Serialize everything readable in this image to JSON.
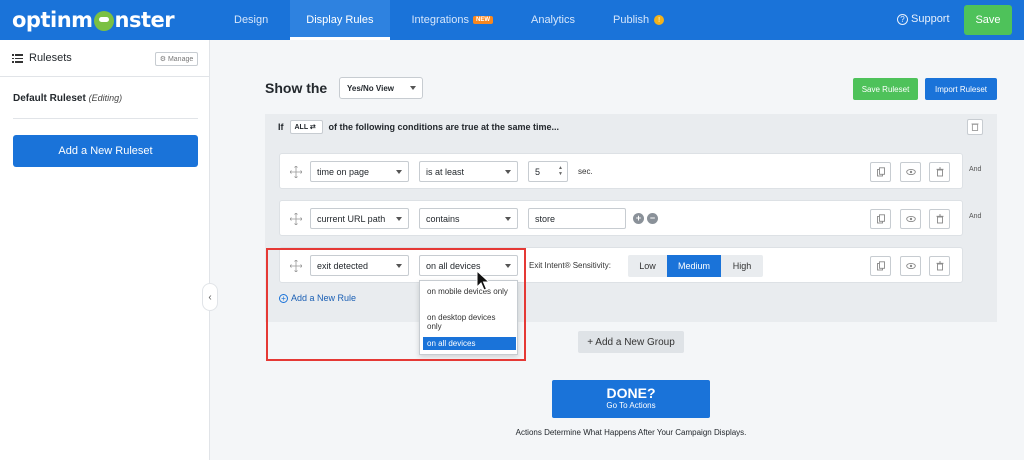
{
  "app": {
    "logo": "optinmonster",
    "nav": [
      {
        "label": "Design"
      },
      {
        "label": "Display Rules"
      },
      {
        "label": "Integrations",
        "badge": "NEW"
      },
      {
        "label": "Analytics"
      },
      {
        "label": "Publish",
        "badge": "!"
      }
    ],
    "support": "Support",
    "save": "Save",
    "colors": {
      "primary": "#1a73d9",
      "green": "#4ec25a",
      "orange": "#f8871f",
      "highlight": "#e53935"
    }
  },
  "sidebar": {
    "title": "Rulesets",
    "manage": "⚙ Manage",
    "ruleset_name": "Default Ruleset",
    "ruleset_state": "(Editing)",
    "add_button": "Add a New Ruleset"
  },
  "main": {
    "show_the": "Show the",
    "view_select": "Yes/No View",
    "save_ruleset": "Save Ruleset",
    "import_ruleset": "Import Ruleset",
    "group": {
      "prefix": "If",
      "quantifier": "ALL ⇄",
      "suffix": "of the following conditions are true at the same time..."
    },
    "rules": [
      {
        "condition": "time on page",
        "operator": "is at least",
        "value": "5",
        "unit": "sec.",
        "joiner": "And"
      },
      {
        "condition": "current URL path",
        "operator": "contains",
        "value": "store",
        "joiner": "And"
      },
      {
        "condition": "exit detected",
        "operator": "on all devices",
        "sensitivity_label": "Exit Intent® Sensitivity:",
        "sensitivity_options": [
          "Low",
          "Medium",
          "High"
        ],
        "sensitivity_selected": "Medium"
      }
    ],
    "dropdown_options": [
      "on mobile devices only",
      "on desktop devices only",
      "on all devices"
    ],
    "dropdown_selected": "on all devices",
    "add_rule": "Add a New Rule",
    "add_group": "+ Add a New Group",
    "done": {
      "title": "DONE?",
      "subtitle": "Go To Actions"
    },
    "footnote": "Actions Determine What Happens After Your Campaign Displays."
  }
}
